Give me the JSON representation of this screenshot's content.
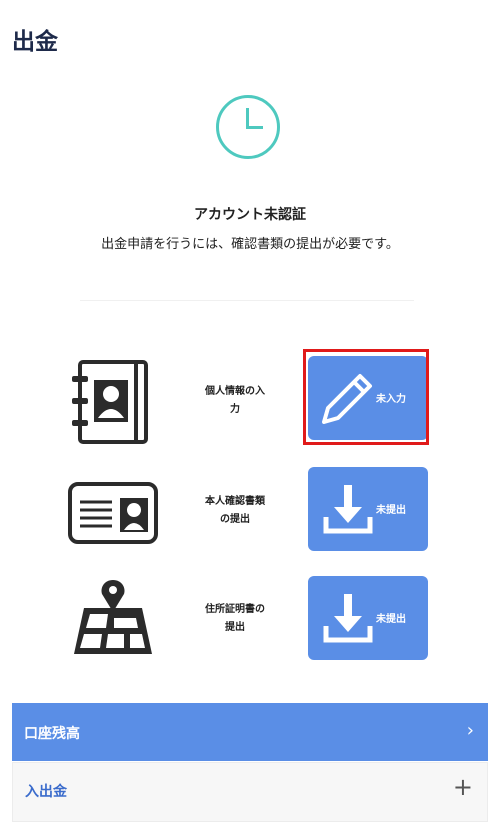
{
  "page": {
    "title": "出金"
  },
  "status": {
    "title": "アカウント未認証",
    "description": "出金申請を行うには、確認書類の提出が必要です。"
  },
  "steps": [
    {
      "label_line1": "個人情報の入",
      "label_line2": "力",
      "button_label": "未入力",
      "icon": "address-book-icon",
      "button_icon": "pencil-icon"
    },
    {
      "label_line1": "本人確認書類",
      "label_line2": "の提出",
      "button_label": "未提出",
      "icon": "id-card-icon",
      "button_icon": "download-icon"
    },
    {
      "label_line1": "住所証明書の",
      "label_line2": "提出",
      "button_label": "未提出",
      "icon": "map-pin-icon",
      "button_icon": "download-icon"
    }
  ],
  "accordion": {
    "balance_label": "口座残高",
    "deposit_label": "入出金"
  },
  "colors": {
    "accent": "#5a8ee6",
    "clock": "#4ec9bf",
    "highlight": "#e01a1a",
    "title": "#1e2a4a"
  }
}
